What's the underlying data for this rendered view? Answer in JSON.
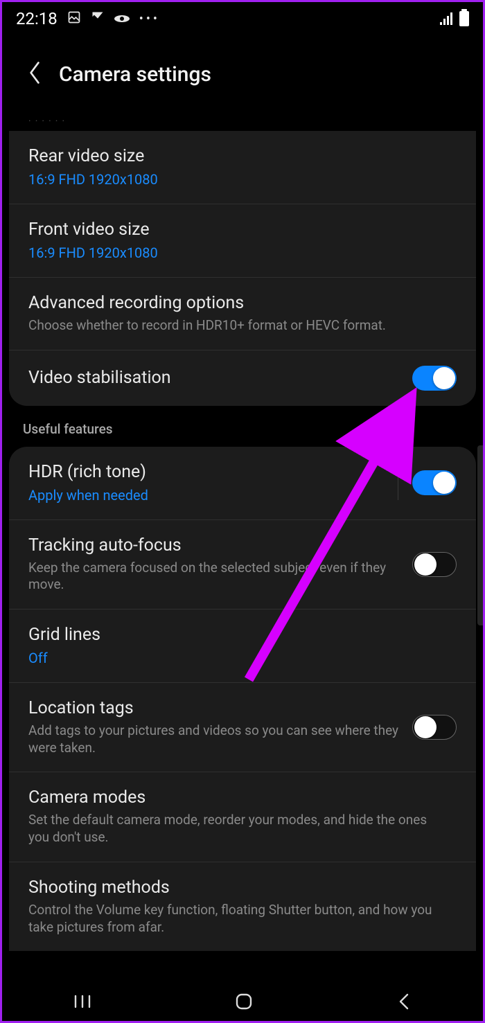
{
  "status": {
    "time": "22:18"
  },
  "header": {
    "title": "Camera settings"
  },
  "section1_partial": "......",
  "rows": {
    "rear_video": {
      "title": "Rear video size",
      "sub": "16:9 FHD 1920x1080"
    },
    "front_video": {
      "title": "Front video size",
      "sub": "16:9 FHD 1920x1080"
    },
    "adv_rec": {
      "title": "Advanced recording options",
      "sub": "Choose whether to record in HDR10+ format or HEVC format."
    },
    "video_stab": {
      "title": "Video stabilisation",
      "on": true
    }
  },
  "section2_label": "Useful features",
  "rows2": {
    "hdr": {
      "title": "HDR (rich tone)",
      "sub": "Apply when needed",
      "on": true
    },
    "tracking": {
      "title": "Tracking auto-focus",
      "sub": "Keep the camera focused on the selected subject even if they move.",
      "on": false
    },
    "grid": {
      "title": "Grid lines",
      "sub": "Off"
    },
    "location": {
      "title": "Location tags",
      "sub": "Add tags to your pictures and videos so you can see where they were taken.",
      "on": false
    },
    "modes": {
      "title": "Camera modes",
      "sub": "Set the default camera mode, reorder your modes, and hide the ones you don't use."
    },
    "shooting": {
      "title": "Shooting methods",
      "sub": "Control the Volume key function, floating Shutter button, and how you take pictures from afar."
    }
  },
  "annotation": {
    "arrow_color": "#d600ff"
  }
}
